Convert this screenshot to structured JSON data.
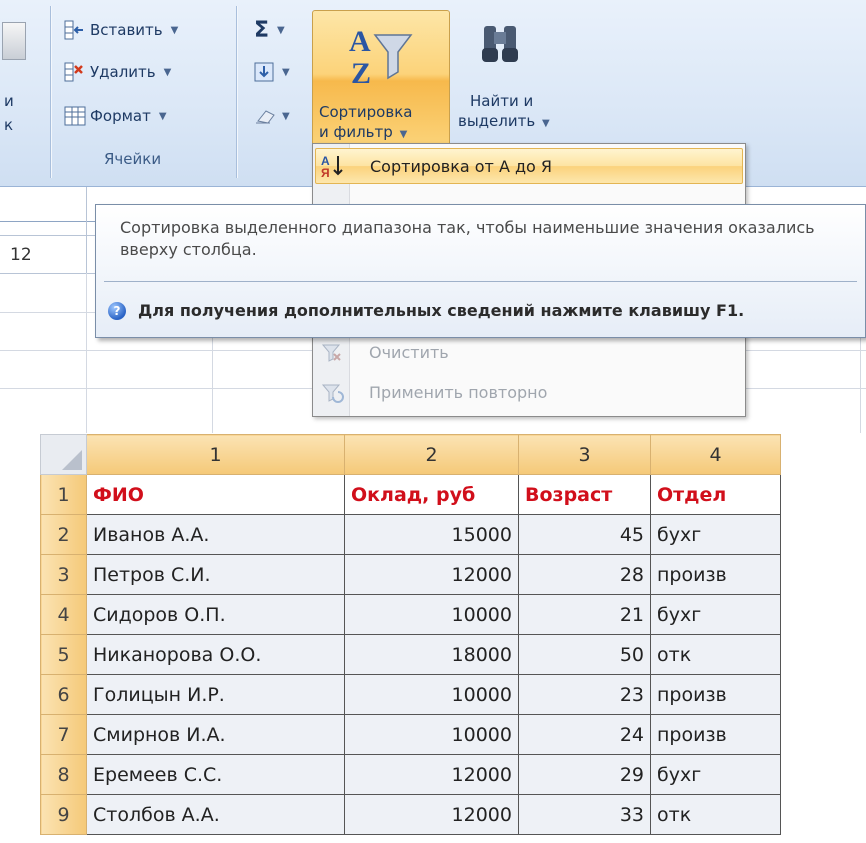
{
  "ribbon": {
    "edge_labels": [
      "и",
      "к"
    ],
    "cells_group": {
      "insert": "Вставить",
      "delete": "Удалить",
      "format": "Формат",
      "label": "Ячейки"
    },
    "sort_button": {
      "line1": "Сортировка",
      "line2": "и фильтр"
    },
    "find_button": {
      "line1": "Найти и",
      "line2": "выделить"
    }
  },
  "name_box_fragment": "12",
  "menu": {
    "items": [
      {
        "label": "Сортировка от А до Я",
        "state": "active"
      },
      {
        "label": "Очистить",
        "state": "disabled"
      },
      {
        "label": "Применить повторно",
        "state": "disabled"
      }
    ]
  },
  "tooltip": {
    "description": "Сортировка выделенного диапазона так, чтобы наименьшие значения оказались вверху столбца.",
    "help": "Для получения дополнительных сведений нажмите клавишу F1."
  },
  "table": {
    "column_headers": [
      "1",
      "2",
      "3",
      "4"
    ],
    "header_row": {
      "num": "1",
      "cells": [
        "ФИО",
        "Оклад, руб",
        "Возраст",
        "Отдел"
      ]
    },
    "rows": [
      {
        "num": "2",
        "name": "Иванов А.А.",
        "salary": "15000",
        "age": "45",
        "dept": "бухг"
      },
      {
        "num": "3",
        "name": "Петров С.И.",
        "salary": "12000",
        "age": "28",
        "dept": "произв"
      },
      {
        "num": "4",
        "name": "Сидоров О.П.",
        "salary": "10000",
        "age": "21",
        "dept": "бухг"
      },
      {
        "num": "5",
        "name": "Никанорова О.О.",
        "salary": "18000",
        "age": "50",
        "dept": "отк"
      },
      {
        "num": "6",
        "name": "Голицын И.Р.",
        "salary": "10000",
        "age": "23",
        "dept": "произв"
      },
      {
        "num": "7",
        "name": "Смирнов И.А.",
        "salary": "10000",
        "age": "24",
        "dept": "произв"
      },
      {
        "num": "8",
        "name": "Еремеев С.С.",
        "salary": "12000",
        "age": "29",
        "dept": "бухг"
      },
      {
        "num": "9",
        "name": "Столбов А.А.",
        "salary": "12000",
        "age": "33",
        "dept": "отк"
      }
    ]
  },
  "colors": {
    "header_text": "#d10f1b",
    "highlight": "#fbd27c",
    "ribbon_bg": "#dce8f7"
  }
}
